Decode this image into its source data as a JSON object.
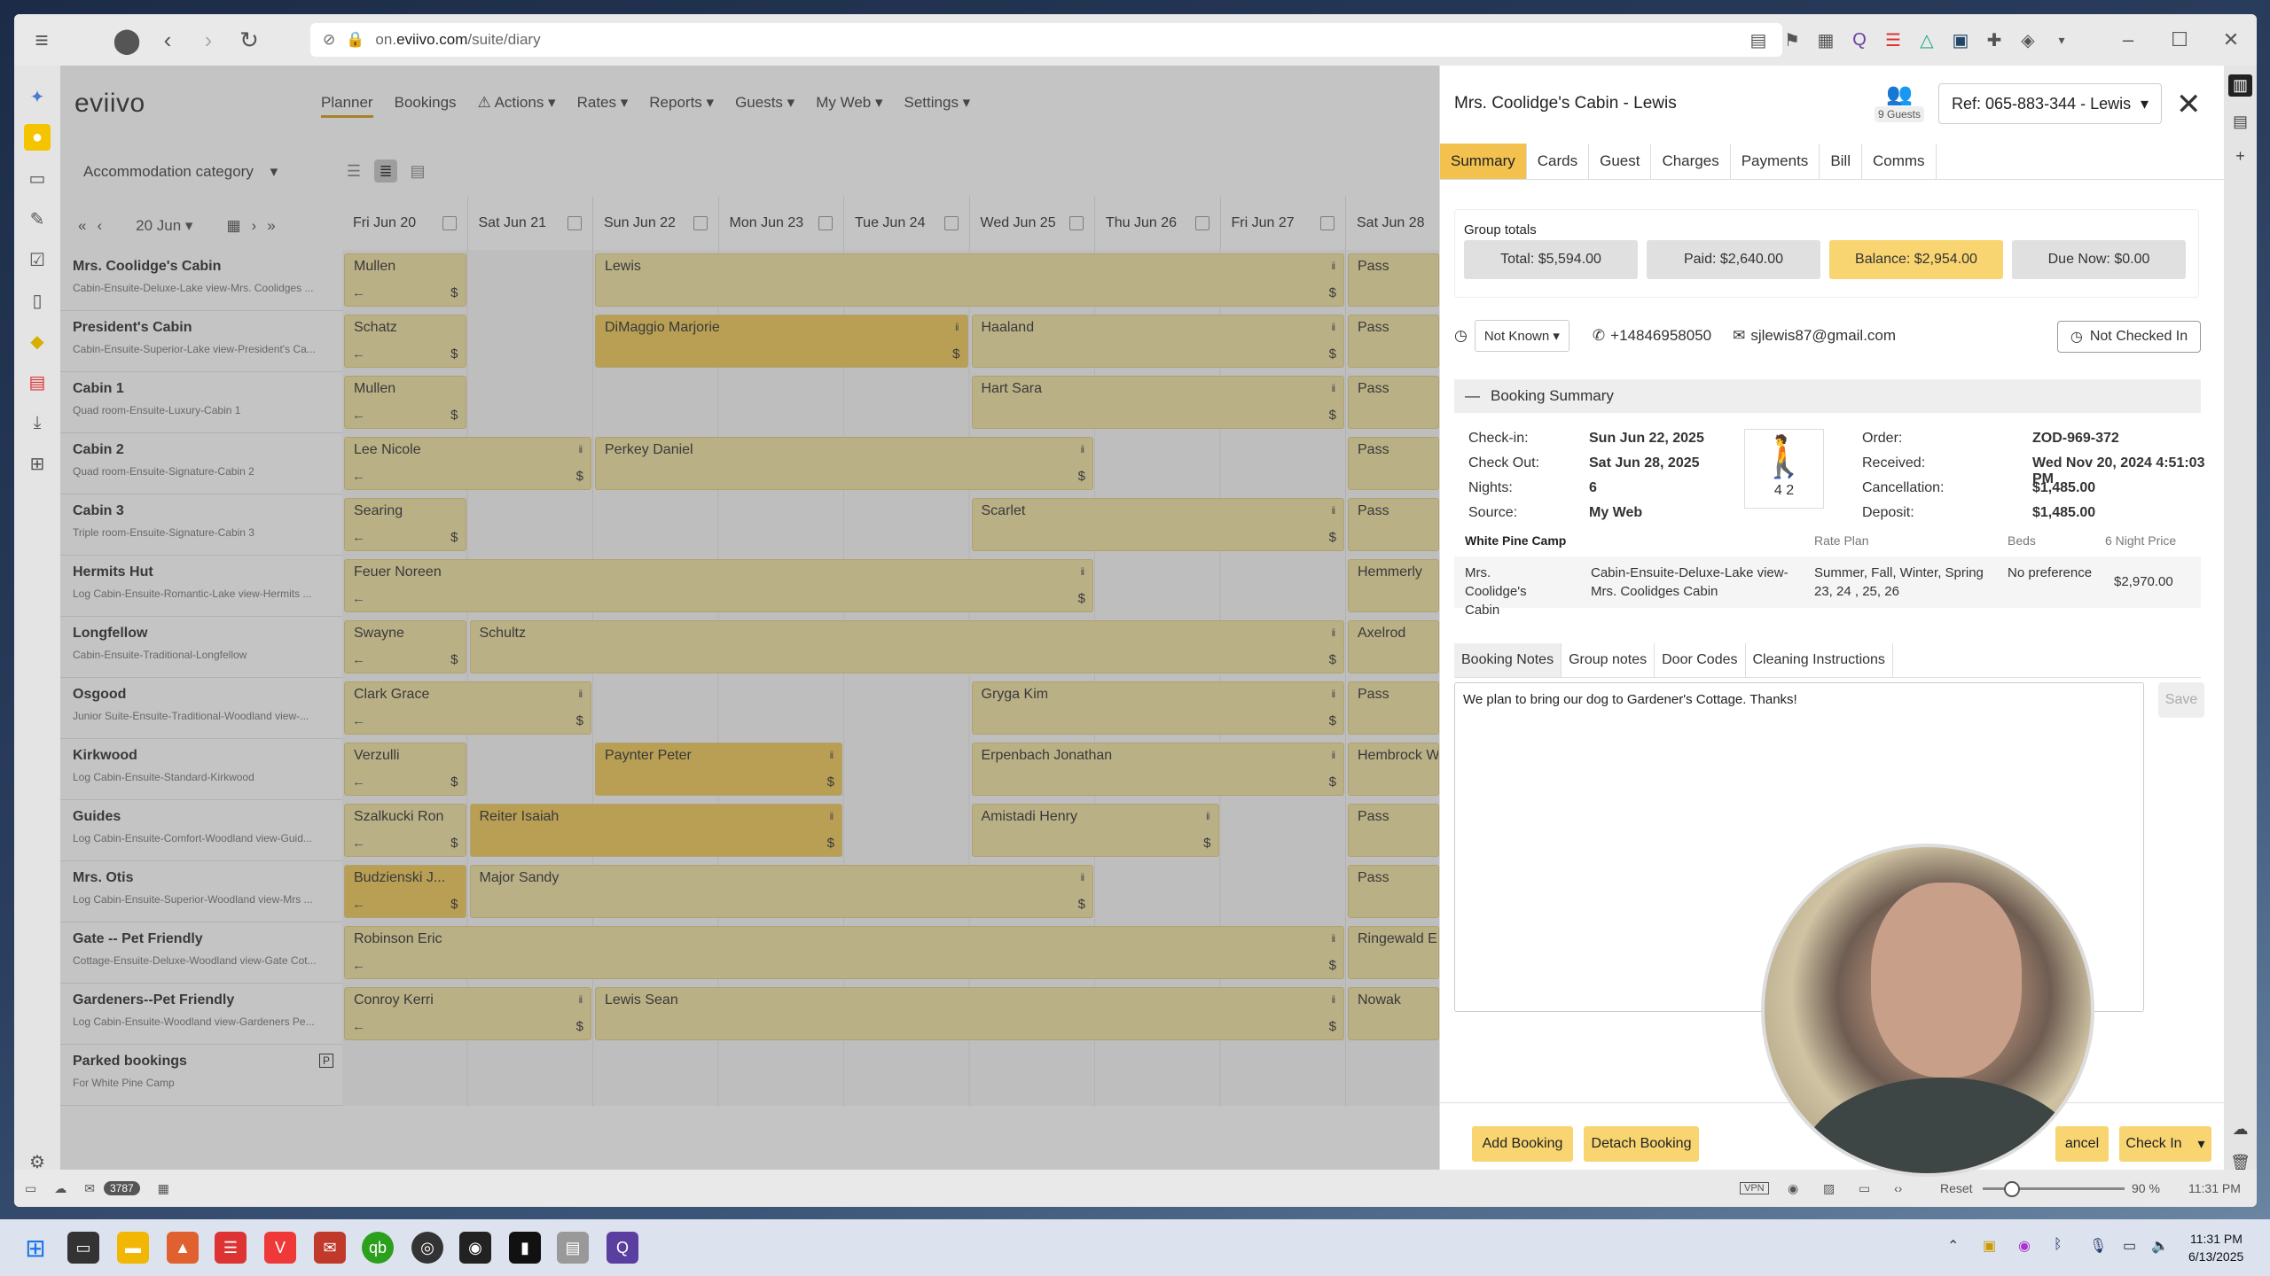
{
  "browser": {
    "url_prefix": "on.",
    "url_domain": "eviivo.com",
    "url_path": "/suite/diary"
  },
  "app": {
    "logo": "eviivo",
    "nav": [
      "Planner",
      "Bookings",
      "Actions",
      "Rates",
      "Reports",
      "Guests",
      "My Web",
      "Settings"
    ],
    "category_select": "Accommodation category",
    "date_select": "20 Jun",
    "days": [
      "Fri Jun 20",
      "Sat Jun 21",
      "Sun Jun 22",
      "Mon Jun 23",
      "Tue Jun 24",
      "Wed Jun 25",
      "Thu Jun 26",
      "Fri Jun 27",
      "Sat Jun 28"
    ],
    "rooms": [
      {
        "name": "Mrs. Coolidge's Cabin",
        "sub": "Cabin-Ensuite-Deluxe-Lake view-Mrs. Coolidges ..."
      },
      {
        "name": "President's Cabin",
        "sub": "Cabin-Ensuite-Superior-Lake view-President's Ca..."
      },
      {
        "name": "Cabin 1",
        "sub": "Quad room-Ensuite-Luxury-Cabin 1"
      },
      {
        "name": "Cabin 2",
        "sub": "Quad room-Ensuite-Signature-Cabin 2"
      },
      {
        "name": "Cabin 3",
        "sub": "Triple room-Ensuite-Signature-Cabin 3"
      },
      {
        "name": "Hermits Hut",
        "sub": "Log Cabin-Ensuite-Romantic-Lake view-Hermits ..."
      },
      {
        "name": "Longfellow",
        "sub": "Cabin-Ensuite-Traditional-Longfellow"
      },
      {
        "name": "Osgood",
        "sub": "Junior Suite-Ensuite-Traditional-Woodland view-..."
      },
      {
        "name": "Kirkwood",
        "sub": "Log Cabin-Ensuite-Standard-Kirkwood"
      },
      {
        "name": "Guides",
        "sub": "Log Cabin-Ensuite-Comfort-Woodland view-Guid..."
      },
      {
        "name": "Mrs. Otis",
        "sub": "Log Cabin-Ensuite-Superior-Woodland view-Mrs ..."
      },
      {
        "name": "Gate -- Pet Friendly",
        "sub": "Cottage-Ensuite-Deluxe-Woodland view-Gate Cot..."
      },
      {
        "name": "Gardeners--Pet Friendly",
        "sub": "Log Cabin-Ensuite-Woodland view-Gardeners Pe..."
      },
      {
        "name": "Parked bookings",
        "sub": "For White Pine Camp"
      }
    ],
    "bookings": [
      {
        "row": 0,
        "start": 0,
        "len": 1,
        "name": "Mullen"
      },
      {
        "row": 0,
        "start": 2,
        "len": 6,
        "name": "Lewis"
      },
      {
        "row": 0,
        "start": 8,
        "len": 1,
        "name": "Pass"
      },
      {
        "row": 1,
        "start": 0,
        "len": 1,
        "name": "Schatz"
      },
      {
        "row": 1,
        "start": 2,
        "len": 3,
        "name": "DiMaggio Marjorie",
        "strong": true
      },
      {
        "row": 1,
        "start": 5,
        "len": 3,
        "name": "Haaland"
      },
      {
        "row": 1,
        "start": 8,
        "len": 1,
        "name": "Pass"
      },
      {
        "row": 2,
        "start": 0,
        "len": 1,
        "name": "Mullen"
      },
      {
        "row": 2,
        "start": 5,
        "len": 3,
        "name": "Hart Sara"
      },
      {
        "row": 2,
        "start": 8,
        "len": 1,
        "name": "Pass"
      },
      {
        "row": 3,
        "start": 0,
        "len": 2,
        "name": "Lee Nicole"
      },
      {
        "row": 3,
        "start": 2,
        "len": 4,
        "name": "Perkey Daniel"
      },
      {
        "row": 3,
        "start": 8,
        "len": 1,
        "name": "Pass"
      },
      {
        "row": 4,
        "start": 0,
        "len": 1,
        "name": "Searing"
      },
      {
        "row": 4,
        "start": 5,
        "len": 3,
        "name": "Scarlet"
      },
      {
        "row": 4,
        "start": 8,
        "len": 1,
        "name": "Pass"
      },
      {
        "row": 5,
        "start": 0,
        "len": 6,
        "name": "Feuer Noreen"
      },
      {
        "row": 5,
        "start": 8,
        "len": 1,
        "name": "Hemmerly"
      },
      {
        "row": 6,
        "start": 0,
        "len": 1,
        "name": "Swayne"
      },
      {
        "row": 6,
        "start": 1,
        "len": 7,
        "name": "Schultz"
      },
      {
        "row": 6,
        "start": 8,
        "len": 1,
        "name": "Axelrod"
      },
      {
        "row": 7,
        "start": 0,
        "len": 2,
        "name": "Clark Grace"
      },
      {
        "row": 7,
        "start": 5,
        "len": 3,
        "name": "Gryga Kim"
      },
      {
        "row": 7,
        "start": 8,
        "len": 1,
        "name": "Pass"
      },
      {
        "row": 8,
        "start": 0,
        "len": 1,
        "name": "Verzulli"
      },
      {
        "row": 8,
        "start": 2,
        "len": 2,
        "name": "Paynter Peter",
        "strong": true
      },
      {
        "row": 8,
        "start": 5,
        "len": 3,
        "name": "Erpenbach Jonathan"
      },
      {
        "row": 8,
        "start": 8,
        "len": 1,
        "name": "Hembrock Wen"
      },
      {
        "row": 9,
        "start": 0,
        "len": 1,
        "name": "Szalkucki Ron"
      },
      {
        "row": 9,
        "start": 1,
        "len": 3,
        "name": "Reiter Isaiah",
        "strong": true
      },
      {
        "row": 9,
        "start": 5,
        "len": 2,
        "name": "Amistadi Henry"
      },
      {
        "row": 9,
        "start": 8,
        "len": 1,
        "name": "Pass"
      },
      {
        "row": 10,
        "start": 0,
        "len": 1,
        "name": "Budzienski J...",
        "strong": true
      },
      {
        "row": 10,
        "start": 1,
        "len": 5,
        "name": "Major Sandy"
      },
      {
        "row": 10,
        "start": 8,
        "len": 1,
        "name": "Pass"
      },
      {
        "row": 11,
        "start": 0,
        "len": 8,
        "name": "Robinson Eric"
      },
      {
        "row": 11,
        "start": 8,
        "len": 1,
        "name": "Ringewald Eric"
      },
      {
        "row": 12,
        "start": 0,
        "len": 2,
        "name": "Conroy Kerri"
      },
      {
        "row": 12,
        "start": 2,
        "len": 6,
        "name": "Lewis Sean"
      },
      {
        "row": 12,
        "start": 8,
        "len": 1,
        "name": "Nowak"
      }
    ]
  },
  "panel": {
    "title": "Mrs. Coolidge's Cabin - Lewis",
    "guests_label": "9 Guests",
    "ref": "Ref: 065-883-344 - Lewis",
    "tabs": [
      "Summary",
      "Cards",
      "Guest",
      "Charges",
      "Payments",
      "Bill",
      "Comms"
    ],
    "group_totals_title": "Group totals",
    "totals": {
      "total": "Total: $5,594.00",
      "paid": "Paid: $2,640.00",
      "balance": "Balance: $2,954.00",
      "due": "Due Now: $0.00"
    },
    "eta_select": "Not Known",
    "phone": "+14846958050",
    "email": "sjlewis87@gmail.com",
    "checkin_status": "Not Checked In",
    "summary_title": "Booking Summary",
    "left_kv": [
      {
        "k": "Check-in:",
        "v": "Sun Jun 22, 2025"
      },
      {
        "k": "Check Out:",
        "v": "Sat Jun 28, 2025"
      },
      {
        "k": "Nights:",
        "v": "6"
      },
      {
        "k": "Source:",
        "v": "My Web"
      }
    ],
    "guest_counts": "4  2",
    "right_kv": [
      {
        "k": "Order:",
        "v": "ZOD-969-372"
      },
      {
        "k": "Received:",
        "v": "Wed Nov 20, 2024 4:51:03 PM"
      },
      {
        "k": "Cancellation:",
        "v": "$1,485.00"
      },
      {
        "k": "Deposit:",
        "v": "$1,485.00"
      }
    ],
    "table": {
      "property": "White Pine Camp",
      "headers": [
        "Rate Plan",
        "Beds",
        "6 Night Price"
      ],
      "room": "Mrs. Coolidge's Cabin",
      "room_type": "Cabin-Ensuite-Deluxe-Lake view-Mrs. Coolidges Cabin",
      "rate_plan": "Summer, Fall, Winter, Spring 23, 24 , 25, 26",
      "beds": "No preference",
      "price": "$2,970.00"
    },
    "note_tabs": [
      "Booking Notes",
      "Group notes",
      "Door Codes",
      "Cleaning Instructions"
    ],
    "note_text": "We plan to bring our dog to Gardener's Cottage. Thanks!",
    "save_label": "Save",
    "footer": {
      "add": "Add Booking",
      "detach": "Detach Booking",
      "cancel": "ancel",
      "checkin": "Check In"
    }
  },
  "status": {
    "badge": "3787",
    "reset": "Reset",
    "zoom": "90 %",
    "time": "11:31 PM"
  },
  "taskbar": {
    "time": "11:31 PM",
    "date": "6/13/2025"
  }
}
